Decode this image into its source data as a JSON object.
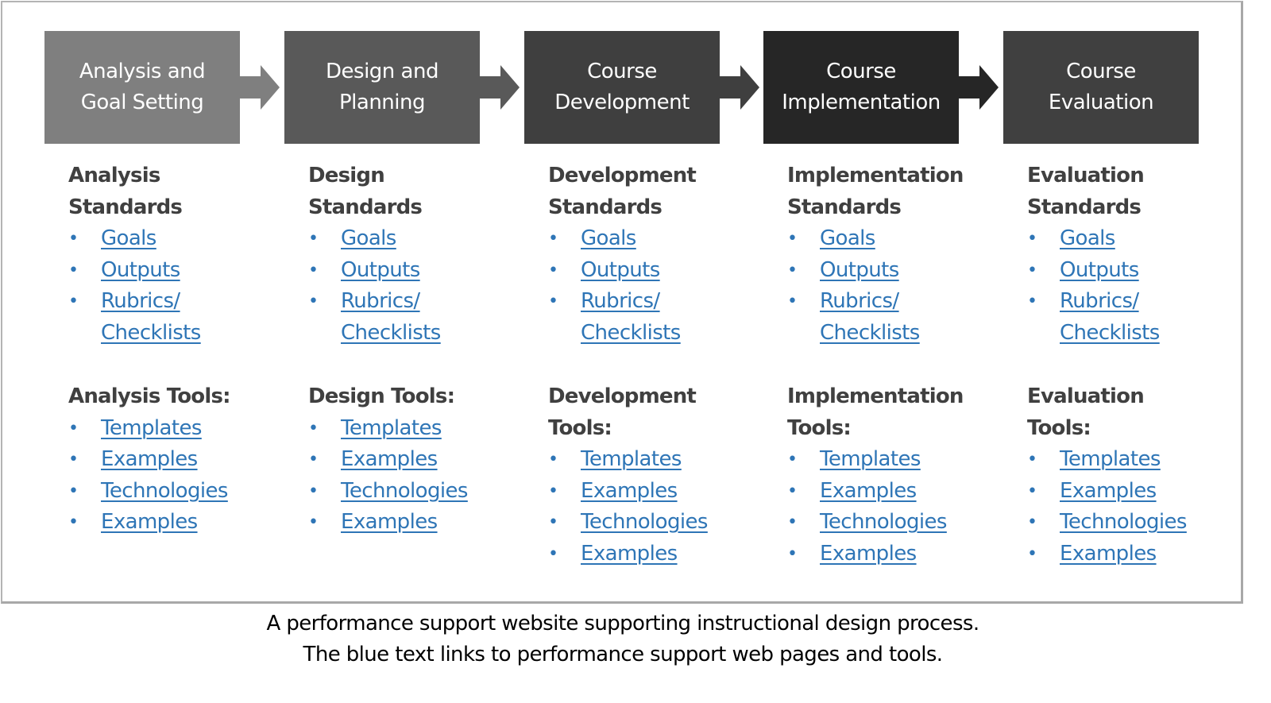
{
  "colors": {
    "link": "#2e75b6",
    "heading": "#404040",
    "stage_fills": [
      "#7f7f7f",
      "#595959",
      "#3f3f3f",
      "#262626",
      "#404040"
    ]
  },
  "stages": [
    {
      "line1": "Analysis and",
      "line2": "Goal Setting",
      "standards_heading": [
        "Analysis",
        "Standards"
      ],
      "standards": [
        "Goals",
        "Outputs",
        "Rubrics/",
        "Checklists"
      ],
      "tools_heading": [
        "Analysis Tools:"
      ],
      "tools": [
        "Templates",
        "Examples",
        "Technologies",
        "Examples"
      ]
    },
    {
      "line1": "Design and",
      "line2": "Planning",
      "standards_heading": [
        "Design",
        "Standards"
      ],
      "standards": [
        "Goals",
        "Outputs",
        "Rubrics/",
        "Checklists"
      ],
      "tools_heading": [
        "Design Tools:"
      ],
      "tools": [
        "Templates",
        "Examples",
        "Technologies",
        "Examples"
      ]
    },
    {
      "line1": "Course",
      "line2": "Development",
      "standards_heading": [
        "Development",
        "Standards"
      ],
      "standards": [
        "Goals",
        "Outputs",
        "Rubrics/",
        "Checklists"
      ],
      "tools_heading": [
        "Development",
        "Tools:"
      ],
      "tools": [
        "Templates",
        "Examples",
        "Technologies",
        "Examples"
      ]
    },
    {
      "line1": "Course",
      "line2": "Implementation",
      "standards_heading": [
        "Implementation",
        "Standards"
      ],
      "standards": [
        "Goals",
        "Outputs",
        "Rubrics/",
        "Checklists"
      ],
      "tools_heading": [
        "Implementation",
        "Tools:"
      ],
      "tools": [
        "Templates",
        "Examples",
        "Technologies",
        "Examples"
      ]
    },
    {
      "line1": "Course",
      "line2": "Evaluation",
      "standards_heading": [
        "Evaluation",
        "Standards"
      ],
      "standards": [
        "Goals",
        "Outputs",
        "Rubrics/",
        "Checklists"
      ],
      "tools_heading": [
        "Evaluation",
        "Tools:"
      ],
      "tools": [
        "Templates",
        "Examples",
        "Technologies",
        "Examples"
      ]
    }
  ],
  "bullet_glyph": "•",
  "caption": {
    "line1": "A performance support website supporting instructional design process.",
    "line2": "The blue text links to performance support web pages and tools."
  }
}
